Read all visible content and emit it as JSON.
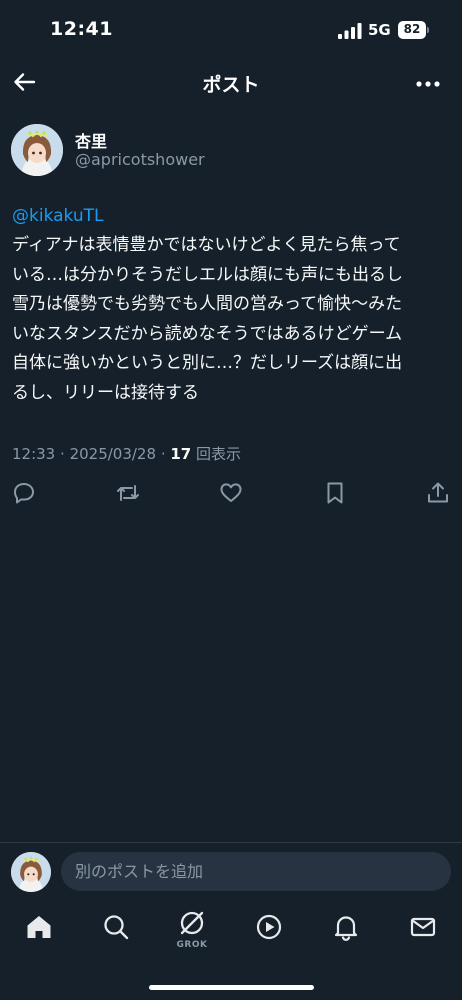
{
  "status_bar": {
    "time": "12:41",
    "network": "5G",
    "battery": "82"
  },
  "header": {
    "title": "ポスト",
    "back_icon": "arrow-left-icon",
    "more_icon": "more-horizontal-icon"
  },
  "tweet": {
    "display_name": "杏里",
    "handle": "@apricotshower",
    "mention": "@kikakuTL",
    "lines": [
      "ディアナは表情豊かではないけどよく見たら焦って",
      "いる…は分かりそうだしエルは顔にも声にも出るし",
      "雪乃は優勢でも劣勢でも人間の営みって愉快〜みた",
      "いなスタンスだから読めなそうではあるけどゲーム",
      "自体に強いかというと別に…？だしリーズは顔に出",
      "るし、リリーは接待する"
    ],
    "time": "12:33",
    "date": "2025/03/28",
    "views": "17",
    "views_label": "回表示"
  },
  "actions": [
    "reply-icon",
    "retweet-icon",
    "like-icon",
    "bookmark-icon",
    "share-icon"
  ],
  "reply_bar": {
    "placeholder": "別のポストを追加"
  },
  "tab_bar": {
    "items": [
      "home-icon",
      "search-icon",
      "grok-icon",
      "video-icon",
      "notifications-icon",
      "messages-icon"
    ],
    "grok_label": "GROK"
  },
  "colors": {
    "background": "#15202b",
    "accent": "#1d9bf0",
    "secondary_text": "#8b98a5",
    "input_bg": "#273340"
  }
}
